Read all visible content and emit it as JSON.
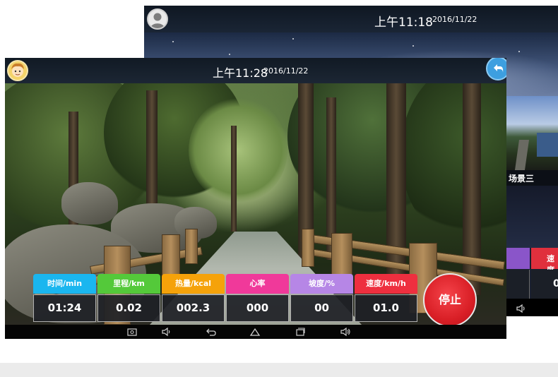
{
  "back_screen": {
    "time": "上午11:18",
    "date": "2016/11/22",
    "scene_label": "场景三",
    "speed_label_partial": "速度",
    "value_partial": "0",
    "avatar_icon": "user-silhouette-icon",
    "nav_icon": "volume-icon"
  },
  "front_screen": {
    "time": "上午11:28",
    "date": "2016/11/22",
    "avatar_icon": "cartoon-avatar-icon",
    "back_icon": "back-arrow-icon",
    "stats": [
      {
        "label": "时间/min",
        "value": "01:24",
        "color": "#1ab6ef"
      },
      {
        "label": "里程/km",
        "value": "0.02",
        "color": "#54c93a"
      },
      {
        "label": "热量/kcal",
        "value": "002.3",
        "color": "#f5a20a"
      },
      {
        "label": "心率",
        "value": "000",
        "color": "#f0399a"
      },
      {
        "label": "坡度/%",
        "value": "00",
        "color": "#b686e6"
      },
      {
        "label": "速度/km/h",
        "value": "01.0",
        "color": "#ee2f3f"
      }
    ],
    "stop_label": "停止",
    "nav_icons": [
      "screenshot-icon",
      "volume-down-icon",
      "back-icon",
      "home-icon",
      "recents-icon",
      "volume-up-icon"
    ]
  }
}
